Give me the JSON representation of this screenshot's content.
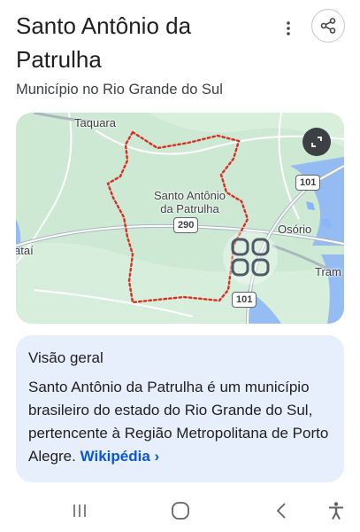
{
  "header": {
    "title": "Santo Antônio da Patrulha",
    "subtitle": "Município no Rio Grande do Sul"
  },
  "icons": {
    "more": "more-vert-icon",
    "share": "share-icon",
    "expand": "fullscreen-icon",
    "lens": "lens-icon"
  },
  "map": {
    "labels": {
      "taquara": "Taquara",
      "city": "Santo Antônio\nda Patrulha",
      "osorio": "Osório",
      "left_cut": "ataí",
      "right_cut": "Tram"
    },
    "shields": {
      "r101_top": "101",
      "r290": "290",
      "r101_bottom": "101"
    }
  },
  "overview": {
    "heading": "Visão geral",
    "text": "Santo Antônio da Patrulha é um município brasileiro do estado do Rio Grande do Sul, pertencente à Região Metropolitana de Porto Alegre.",
    "link": "Wikipédia ›"
  },
  "colors": {
    "accent": "#0b57d0",
    "card_bg": "#e8effc",
    "boundary": "#d93025",
    "map_land": "#cfe9d6",
    "water": "#8ab4f8"
  }
}
